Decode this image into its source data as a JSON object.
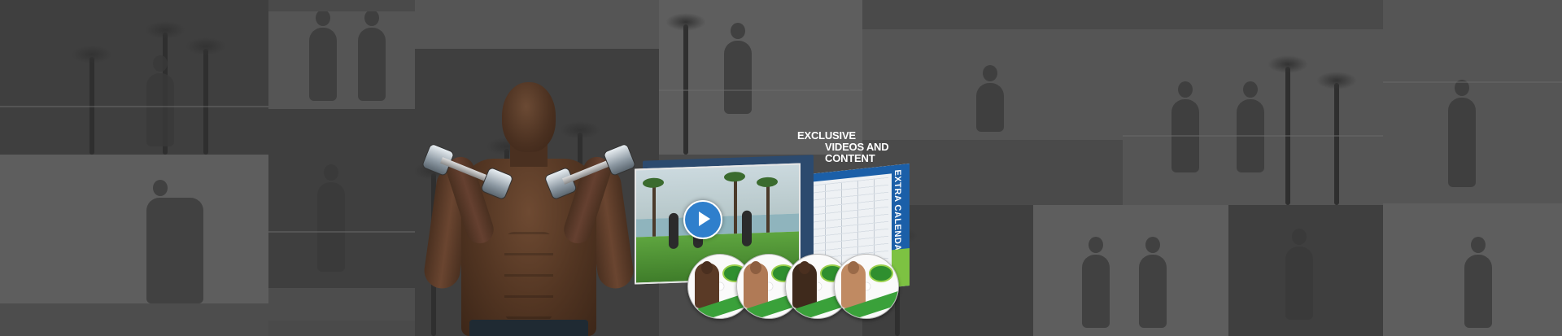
{
  "banner": {
    "headline": {
      "line1": "EXCLUSIVE",
      "line2": "VIDEOS AND",
      "line3": "CONTENT"
    },
    "calendar_label": "EXTRA CALENDARS",
    "play_icon": "play-icon"
  },
  "discs": [
    {
      "label": "disc-1"
    },
    {
      "label": "disc-2"
    },
    {
      "label": "disc-3"
    },
    {
      "label": "disc-4"
    }
  ]
}
